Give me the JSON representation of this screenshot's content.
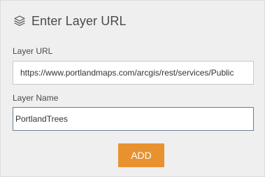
{
  "header": {
    "icon": "layers-icon",
    "title": "Enter Layer URL"
  },
  "url_field": {
    "label": "Layer URL",
    "value": "https://www.portlandmaps.com/arcgis/rest/services/Public"
  },
  "name_field": {
    "label": "Layer Name",
    "value": "PortlandTrees"
  },
  "add_button": {
    "label": "ADD"
  },
  "colors": {
    "panel_background": "#efefef",
    "accent_button": "#e8922f",
    "focused_border": "#6a7d9b",
    "text": "#4a4a4a"
  }
}
